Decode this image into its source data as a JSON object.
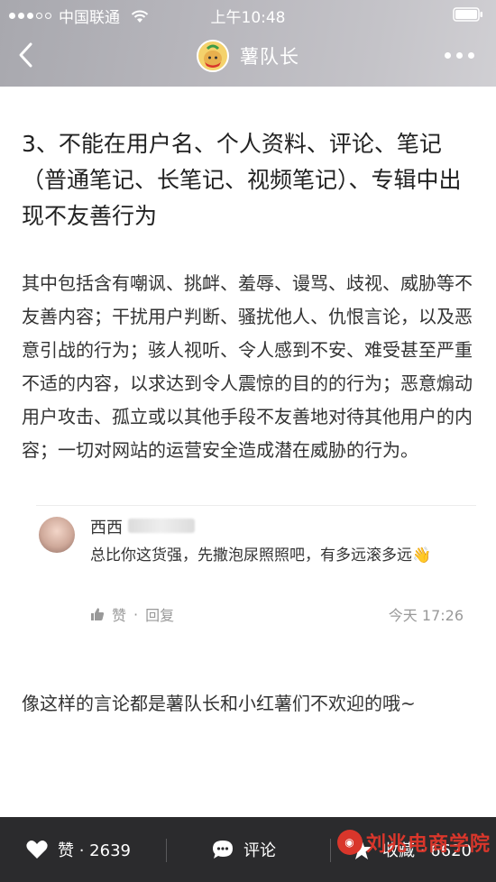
{
  "status": {
    "carrier": "中国联通",
    "time": "上午10:48"
  },
  "nav": {
    "title": "薯队长",
    "back_icon": "chevron-left-icon",
    "more_icon": "more-dots-icon"
  },
  "article": {
    "heading": "3、不能在用户名、个人资料、评论、笔记（普通笔记、长笔记、视频笔记）、专辑中出现不友善行为",
    "body": "其中包括含有嘲讽、挑衅、羞辱、谩骂、歧视、威胁等不友善内容；干扰用户判断、骚扰他人、仇恨言论，以及恶意引战的行为；骇人视听、令人感到不安、难受甚至严重不适的内容，以求达到令人震惊的目的的行为；恶意煽动用户攻击、孤立或以其他手段不友善地对待其他用户的内容；一切对网站的运营安全造成潜在威胁的行为。",
    "closing": "像这样的言论都是薯队长和小红薯们不欢迎的哦~"
  },
  "comment": {
    "author": "西西",
    "text": "总比你这货强，先撒泡尿照照吧，有多远滚多远👋",
    "like_label": "赞",
    "separator": "·",
    "reply_label": "回复",
    "time": "今天 17:26"
  },
  "bottom_bar": {
    "like_label": "赞 · 2639",
    "comment_label": "评论",
    "favorite_label": "收藏 · 6620"
  },
  "watermark": {
    "text": "刘兆电商学院"
  },
  "colors": {
    "header_bg": "#b7b6bc",
    "bottom_bar_bg": "#2b2b2d",
    "watermark": "#d9362b"
  }
}
